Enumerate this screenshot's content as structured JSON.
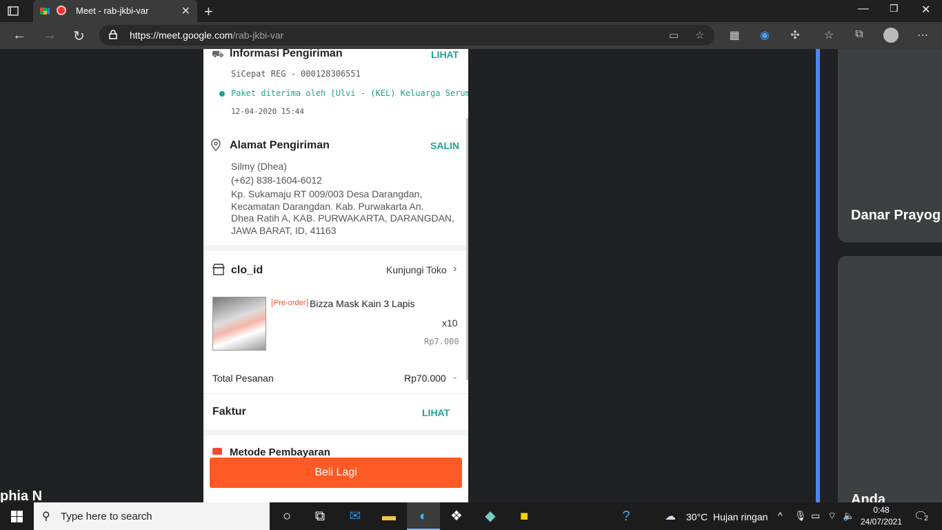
{
  "browser": {
    "tab_title": "Meet - rab-jkbi-var",
    "url_host": "https://meet.google.com",
    "url_path": "/rab-jkbi-var"
  },
  "order": {
    "shipping": {
      "title": "Informasi Pengiriman",
      "action": "LIHAT",
      "courier": "SiCepat REG - 000128306551",
      "status": "Paket diterima oleh [Ulvi - (KEL) Keluarga Serumah]",
      "timestamp": "12-04-2020 15:44"
    },
    "address": {
      "title": "Alamat Pengiriman",
      "action": "SALIN",
      "name": "Silmy (Dhea)",
      "phone": "(+62) 838-1604-6012",
      "line1": "Kp. Sukamaju RT 009/003 Desa Darangdan,",
      "line2": "Kecamatan Darangdan. Kab. Purwakarta An.",
      "line3": "Dhea Ratih A, KAB. PURWAKARTA, DARANGDAN,",
      "line4": "JAWA BARAT, ID, 41163"
    },
    "shop": {
      "name": "clo_id",
      "visit": "Kunjungi Toko"
    },
    "product": {
      "badge": "Pre-order",
      "name": "Bizza Mask Kain 3 Lapis",
      "qty": "x10",
      "price": "Rp7.000"
    },
    "total": {
      "label": "Total Pesanan",
      "value": "Rp70.000"
    },
    "invoice": {
      "label": "Faktur",
      "action": "LIHAT"
    },
    "payment_partial": "Metode Pembayaran",
    "buy_again": "Beli Lagi"
  },
  "participants": {
    "left_name": "phia N",
    "right_name": "Danar Prayog",
    "self_name": "Anda"
  },
  "taskbar": {
    "search_placeholder": "Type here to search",
    "weather_temp": "30°C",
    "weather_desc": "Hujan ringan",
    "time": "0:48",
    "date": "24/07/2021",
    "notification_count": "2"
  }
}
